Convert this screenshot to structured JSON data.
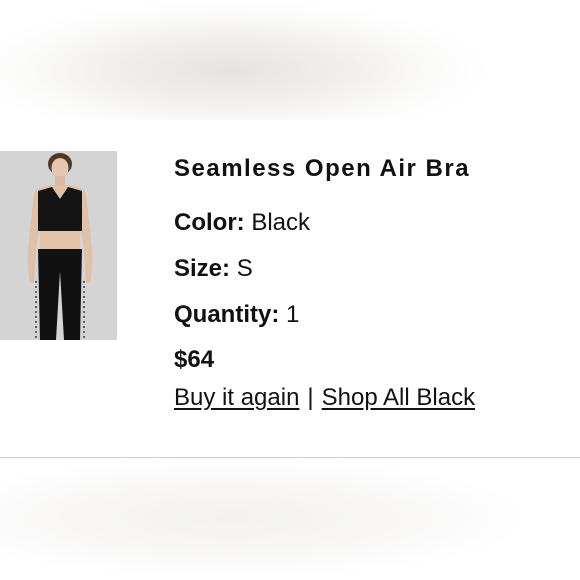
{
  "product": {
    "title": "Seamless Open Air Bra",
    "image_alt": "Model wearing black open air bra and black leggings",
    "color_label": "Color:",
    "color_value": "Black",
    "size_label": "Size:",
    "size_value": "S",
    "quantity_label": "Quantity:",
    "quantity_value": "1",
    "price": "$64"
  },
  "actions": {
    "buy_again": "Buy it again",
    "separator": "|",
    "shop_all": "Shop All Black"
  },
  "colors": {
    "text": "#111111",
    "image_background": "#d5d5d5",
    "divider": "#cfcfcf"
  }
}
